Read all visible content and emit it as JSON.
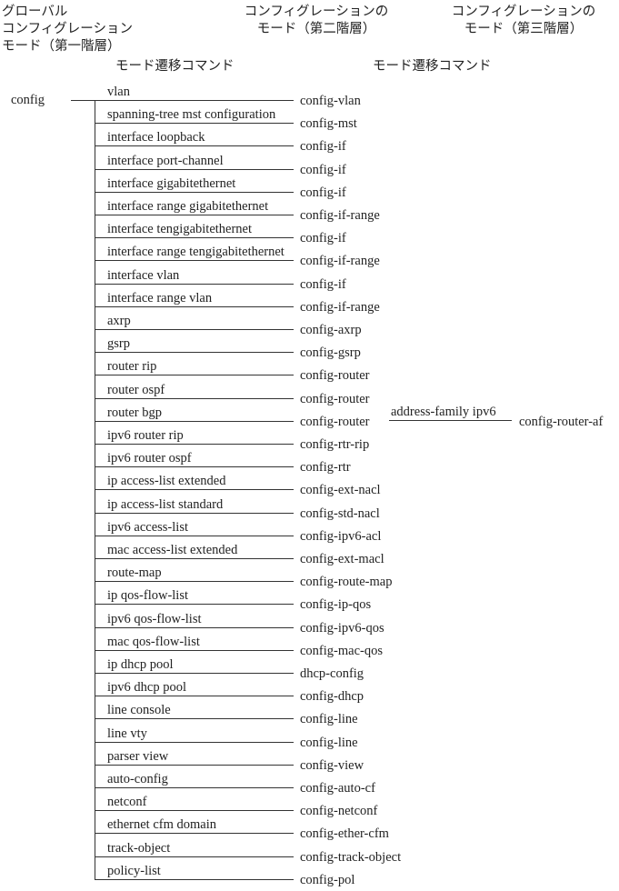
{
  "headers": {
    "level1": [
      "グローバル",
      "コンフィグレーション",
      "モード（第一階層）"
    ],
    "level2": [
      "コンフィグレーションの",
      "モード（第二階層）"
    ],
    "level3": [
      "コンフィグレーションの",
      "モード（第三階層）"
    ],
    "transition_cmd_1": "モード遷移コマンド",
    "transition_cmd_2": "モード遷移コマンド"
  },
  "root_mode": "config",
  "commands": [
    {
      "command": "vlan",
      "mode": "config-vlan"
    },
    {
      "command": "spanning-tree mst configuration",
      "mode": "config-mst"
    },
    {
      "command": "interface loopback",
      "mode": "config-if"
    },
    {
      "command": "interface port-channel",
      "mode": "config-if"
    },
    {
      "command": "interface gigabitethernet",
      "mode": "config-if"
    },
    {
      "command": "interface range gigabitethernet",
      "mode": "config-if-range"
    },
    {
      "command": "interface tengigabitethernet",
      "mode": "config-if"
    },
    {
      "command": "interface range tengigabitethernet",
      "mode": "config-if-range"
    },
    {
      "command": "interface vlan",
      "mode": "config-if"
    },
    {
      "command": "interface range vlan",
      "mode": "config-if-range"
    },
    {
      "command": "axrp",
      "mode": "config-axrp"
    },
    {
      "command": "gsrp",
      "mode": "config-gsrp"
    },
    {
      "command": "router rip",
      "mode": "config-router"
    },
    {
      "command": "router ospf",
      "mode": "config-router"
    },
    {
      "command": "router bgp",
      "mode": "config-router"
    },
    {
      "command": "ipv6 router rip",
      "mode": "config-rtr-rip"
    },
    {
      "command": "ipv6 router ospf",
      "mode": "config-rtr"
    },
    {
      "command": "ip access-list extended",
      "mode": "config-ext-nacl"
    },
    {
      "command": "ip access-list standard",
      "mode": "config-std-nacl"
    },
    {
      "command": "ipv6 access-list",
      "mode": "config-ipv6-acl"
    },
    {
      "command": "mac access-list extended",
      "mode": "config-ext-macl"
    },
    {
      "command": "route-map",
      "mode": "config-route-map"
    },
    {
      "command": "ip qos-flow-list",
      "mode": "config-ip-qos"
    },
    {
      "command": "ipv6 qos-flow-list",
      "mode": "config-ipv6-qos"
    },
    {
      "command": "mac qos-flow-list",
      "mode": "config-mac-qos"
    },
    {
      "command": "ip dhcp pool",
      "mode": "dhcp-config"
    },
    {
      "command": "ipv6 dhcp pool",
      "mode": "config-dhcp"
    },
    {
      "command": "line console",
      "mode": "config-line"
    },
    {
      "command": "line vty",
      "mode": "config-line"
    },
    {
      "command": "parser view",
      "mode": "config-view"
    },
    {
      "command": "auto-config",
      "mode": "config-auto-cf"
    },
    {
      "command": "netconf",
      "mode": "config-netconf"
    },
    {
      "command": "ethernet cfm domain",
      "mode": "config-ether-cfm"
    },
    {
      "command": "track-object",
      "mode": "config-track-object"
    },
    {
      "command": "policy-list",
      "mode": "config-pol"
    }
  ],
  "third_level": {
    "from_row_index": 14,
    "command": "address-family ipv6",
    "mode": "config-router-af"
  }
}
